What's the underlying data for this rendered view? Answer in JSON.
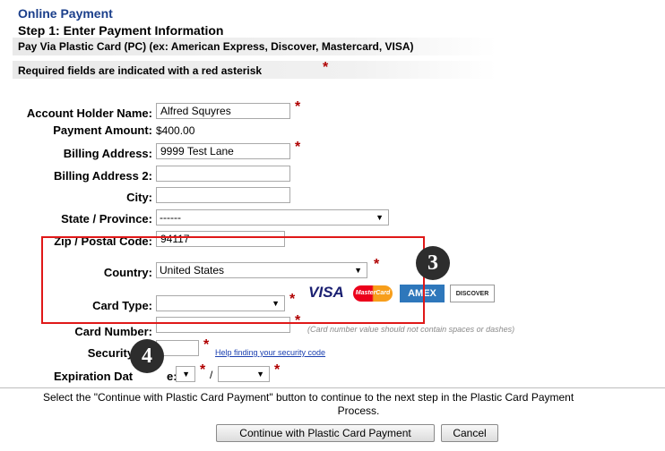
{
  "header": {
    "title": "Online Payment",
    "step": "Step 1: Enter Payment Information",
    "pay_via": "Pay Via Plastic Card (PC) (ex: American Express, Discover, Mastercard, VISA)",
    "required_note": "Required fields are indicated with a red asterisk",
    "required_mark": "*"
  },
  "form": {
    "account_holder_label": "Account Holder Name:",
    "account_holder_value": "Alfred Squyres",
    "payment_amount_label": "Payment Amount:",
    "payment_amount_value": "$400.00",
    "billing_address_label": "Billing Address:",
    "billing_address_value": "9999 Test Lane",
    "billing_address2_label": "Billing Address 2:",
    "billing_address2_value": "",
    "city_label": "City:",
    "city_value": "",
    "state_label": "State / Province:",
    "state_value": "------",
    "zip_label": "Zip / Postal Code:",
    "zip_value": "94117",
    "country_label": "Country:",
    "country_value": "United States",
    "card_type_label": "Card Type:",
    "card_type_value": "",
    "card_number_label": "Card Number:",
    "card_number_value": "",
    "card_number_hint": "(Card number value should not contain spaces or dashes)",
    "security_code_label": "Security Co",
    "security_code_value": "",
    "security_help": "Help finding your security code",
    "expiration_label": "Expiration Dat",
    "expiration_label_tail": "e:",
    "expiration_month": "",
    "expiration_year": "",
    "expiration_sep": "/",
    "asterisk": "*"
  },
  "card_logos": {
    "visa": "VISA",
    "mastercard": "MasterCard",
    "amex": "AMEX",
    "discover": "DISCOVER"
  },
  "annotations": {
    "badge3": "3",
    "badge4": "4",
    "highlight_color": "#e01818"
  },
  "footer": {
    "instruction_line1": "Select the \"Continue with Plastic Card Payment\" button to continue to the next step in the Plastic Card Payment",
    "instruction_line2": "Process.",
    "continue_button": "Continue with Plastic Card Payment",
    "cancel_button": "Cancel"
  },
  "colors": {
    "title_blue": "#1b3f8b",
    "asterisk_red": "#b00000",
    "visa_blue": "#1a1f71",
    "mastercard_red": "#eb001b",
    "amex_blue": "#2e77bb",
    "discover_orange": "#f48120"
  },
  "icons": {
    "dropdown": "chevron-down-icon"
  }
}
